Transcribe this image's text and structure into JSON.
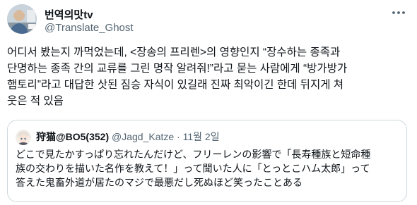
{
  "author": {
    "display_name": "번역의맛tv",
    "handle": "@Translate_Ghost",
    "avatar_icon": "user-avatar-photo"
  },
  "more_icon": "more-horizontal-icon",
  "tweet": {
    "lines": [
      "어디서 봤는지 까먹었는데, <장송의 프리렌>의 영향인지 “장수하는 종족과",
      "단명하는 종족 간의 교류를 그린 명작 알려줘!”라고 묻는 사람에게 “방가방가",
      "햄토리”라고 대답한 삿된 짐승 자식이 있길래 진짜 최악이긴 한데 뒤지게 쳐",
      "웃은 적 있음"
    ]
  },
  "quoted": {
    "display_name": "狩猫@BO5(352)",
    "handle": "@Jagd_Katze",
    "separator": "·",
    "date": "11월 2일",
    "avatar_icon": "anime-character-avatar",
    "lines": [
      "どこで見たかすっぱり忘れたんだけど、フリーレンの影響で「長寿種族と短命種",
      "族の交わりを描いた名作を教えて！」って聞いた人に「とっとこハム太郎」って",
      "答えた鬼畜外道が居たのマジで最悪だし死ぬほど笑ったことある"
    ]
  },
  "colors": {
    "text": "#0f1419",
    "secondary": "#536471",
    "border": "#cfd9de"
  }
}
